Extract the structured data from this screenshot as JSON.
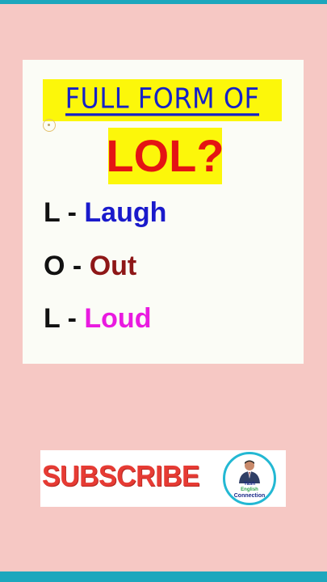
{
  "card": {
    "heading": "FULL FORM OF",
    "term": "LOL?",
    "rows": [
      {
        "letter": "L",
        "dash": "-",
        "word": "Laugh"
      },
      {
        "letter": "O",
        "dash": "-",
        "word": "Out"
      },
      {
        "letter": "L",
        "dash": "-",
        "word": "Loud"
      }
    ]
  },
  "banner": {
    "label": "SUBSCRIBE",
    "logo_line1": "Yash",
    "logo_line2": "English",
    "logo_line3": "Connection"
  },
  "colors": {
    "background": "#f6c8c4",
    "highlight": "#fcf70a",
    "heading": "#1521c8",
    "term": "#e41414",
    "laugh": "#1a1acb",
    "out": "#8e1717",
    "loud": "#e91ae0",
    "subscribe": "#e63b34",
    "accent_bar": "#1da7bd"
  },
  "icons": [
    "cursor-ring-icon",
    "avatar-icon"
  ]
}
